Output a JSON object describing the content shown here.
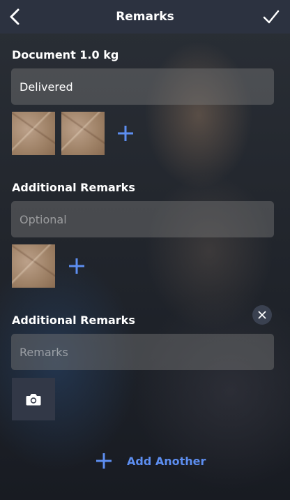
{
  "header": {
    "title": "Remarks"
  },
  "sections": [
    {
      "title": "Document 1.0 kg",
      "value": "Delivered",
      "placeholder": "",
      "photo_count": 2
    },
    {
      "title": "Additional Remarks",
      "value": "",
      "placeholder": "Optional",
      "photo_count": 1
    },
    {
      "title": "Additional Remarks",
      "value": "",
      "placeholder": "Remarks",
      "photo_count": 0
    }
  ],
  "footer": {
    "add_another_label": "Add Another"
  },
  "colors": {
    "accent": "#5d8ef0",
    "header_bg": "#2c3240"
  }
}
